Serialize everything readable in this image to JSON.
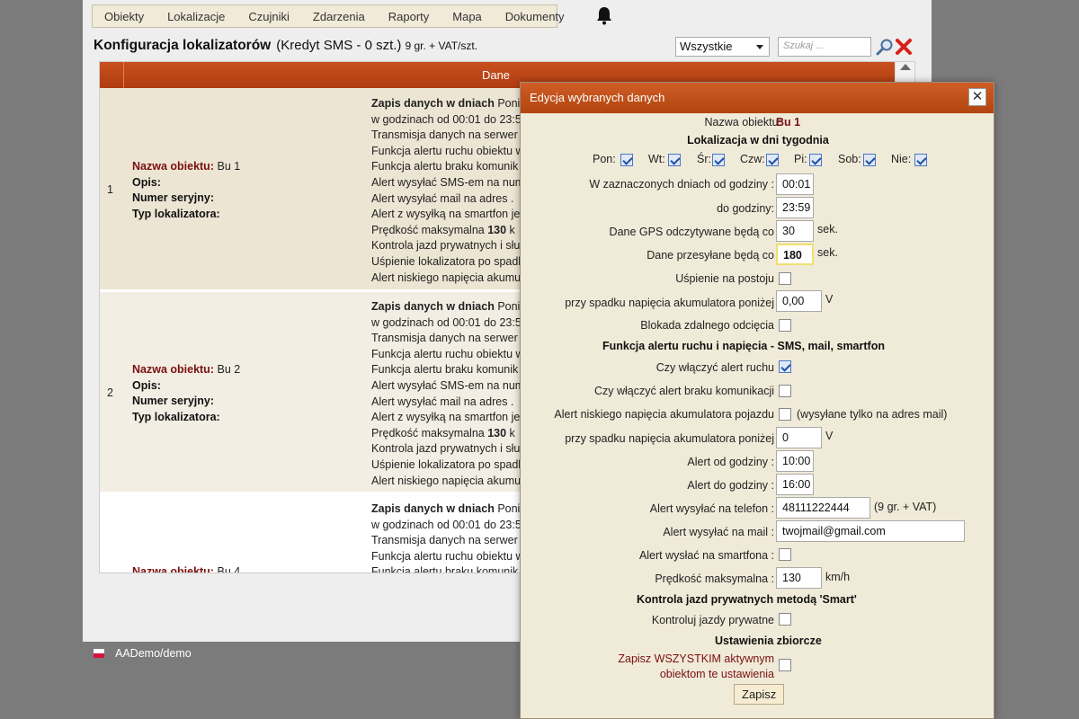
{
  "menu": [
    "Obiekty",
    "Lokalizacje",
    "Czujniki",
    "Zdarzenia",
    "Raporty",
    "Mapa",
    "Dokumenty"
  ],
  "title": {
    "main": "Konfiguracja lokalizatorów",
    "credit": "(Kredyt SMS - 0 szt.)",
    "price": "9 gr. + VAT/szt."
  },
  "filter": {
    "value": "Wszystkie"
  },
  "search": {
    "placeholder": "Szukaj ..."
  },
  "grid": {
    "header": "Dane",
    "labels": {
      "name": "Nazwa obiektu:",
      "desc": "Opis:",
      "serial": "Numer seryjny:",
      "type": "Typ lokalizatora:"
    },
    "rows": [
      {
        "num": "1",
        "name": "Bu 1"
      },
      {
        "num": "2",
        "name": "Bu 2"
      },
      {
        "num": "",
        "name": "Bu 4"
      }
    ],
    "details": {
      "l1_bold": "Zapis danych w dniach",
      "l1_rest": " Ponie",
      "l2": "w godzinach od 00:01 do 23:5",
      "l3": "Transmisja danych na serwer c",
      "l4": "Funkcja alertu ruchu obiektu w",
      "l5": "Funkcja alertu braku komunik",
      "l6": "Alert wysyłać SMS-em na num",
      "l7": "Alert wysyłać mail na adres .",
      "l8": "Alert z wysyłką na smartfon je",
      "l9_pre": "Prędkość maksymalna ",
      "l9_bold": "130",
      "l9_post": " k",
      "l10": "Kontrola jazd prywatnych i słu",
      "l11": "Uśpienie lokalizatora po spadk",
      "l12": "Alert niskiego napięcia akumul"
    }
  },
  "footer": {
    "user": "AADemo/demo"
  },
  "dialog": {
    "title": "Edycja wybranych danych",
    "object_label": "Nazwa obiektu:",
    "object_name": "Bu 1",
    "sec_days": "Lokalizacja w dni tygodnia",
    "days": [
      {
        "label": "Pon:",
        "checked": true
      },
      {
        "label": "Wt:",
        "checked": true
      },
      {
        "label": "Śr:",
        "checked": true
      },
      {
        "label": "Czw:",
        "checked": true
      },
      {
        "label": "Pi:",
        "checked": true
      },
      {
        "label": "Sob:",
        "checked": true
      },
      {
        "label": "Nie:",
        "checked": true
      }
    ],
    "from_label": "W zaznaczonych dniach od godziny :",
    "from_value": "00:01",
    "to_label": "do godziny:",
    "to_value": "23:59",
    "gps_label": "Dane GPS odczytywane będą co",
    "gps_value": "30",
    "gps_unit": "sek.",
    "send_label": "Dane przesyłane będą co",
    "send_value": "180",
    "send_unit": "sek.",
    "sleep_label": "Uśpienie na postoju",
    "sleep_checked": false,
    "voltage_label": "przy spadku napięcia akumulatora poniżej",
    "voltage_value": "0,00",
    "voltage_unit": "V",
    "block_label": "Blokada zdalnego odcięcia",
    "block_checked": false,
    "sec_alert": "Funkcja alertu ruchu i napięcia - SMS, mail, smartfon",
    "motion_label": "Czy włączyć alert ruchu",
    "motion_checked": true,
    "nocomm_label": "Czy włączyć alert braku komunikacji",
    "nocomm_checked": false,
    "lowvolt_label": "Alert niskiego napięcia akumulatora pojazdu",
    "lowvolt_checked": false,
    "lowvolt_note": "(wysyłane tylko na adres mail)",
    "voltage2_label": "przy spadku napięcia akumulatora poniżej",
    "voltage2_value": "0",
    "voltage2_unit": "V",
    "alert_from_label": "Alert od godziny :",
    "alert_from_value": "10:00",
    "alert_to_label": "Alert do godziny :",
    "alert_to_value": "16:00",
    "phone_label": "Alert wysyłać na telefon :",
    "phone_value": "48111222444",
    "phone_note": "(9 gr. + VAT)",
    "mail_label": "Alert wysyłać na mail :",
    "mail_value": "twojmail@gmail.com",
    "smart_label": "Alert wysłać na smartfona :",
    "smart_checked": false,
    "speed_label": "Prędkość maksymalna :",
    "speed_value": "130",
    "speed_unit": "km/h",
    "sec_private": "Kontrola jazd prywatnych metodą 'Smart'",
    "private_label": "Kontroluj jazdy prywatne",
    "private_checked": false,
    "sec_bulk": "Ustawienia zbiorcze",
    "bulk_label1": "Zapisz WSZYSTKIM aktywnym",
    "bulk_label2": "obiektom te ustawienia",
    "bulk_checked": false,
    "save_label": "Zapisz"
  }
}
